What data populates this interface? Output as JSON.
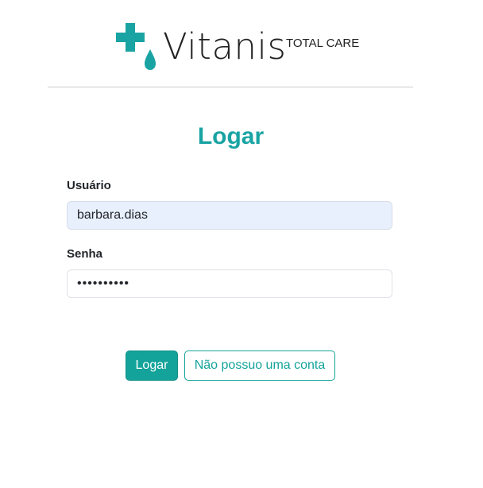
{
  "brand": {
    "name": "Vitanis",
    "tagline": "TOTAL CARE",
    "accent_color": "#1aa3a3",
    "icon": "medical-cross-drop-icon"
  },
  "login": {
    "title": "Logar",
    "username_label": "Usuário",
    "username_value": "barbara.dias",
    "password_label": "Senha",
    "password_value": "••••••••••"
  },
  "actions": {
    "login_button": "Logar",
    "no_account_button": "Não possuo uma conta"
  }
}
